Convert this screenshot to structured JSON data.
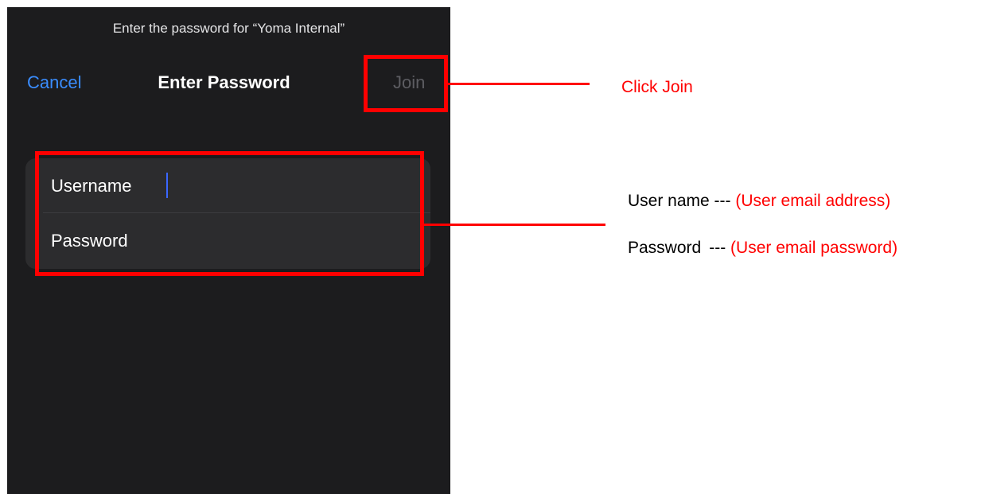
{
  "dialog": {
    "prompt": "Enter the password for “Yoma Internal”",
    "title": "Enter Password",
    "cancel_label": "Cancel",
    "join_label": "Join",
    "fields": [
      {
        "label": "Username",
        "value": ""
      },
      {
        "label": "Password",
        "value": ""
      }
    ]
  },
  "annotations": {
    "join": "Click Join",
    "username_label": "User name ---",
    "username_hint": "(User email address)",
    "password_label": "Password",
    "password_sep": "---",
    "password_hint": "(User email password)"
  },
  "colors": {
    "highlight": "#ff0000",
    "accent": "#3a8dff",
    "background": "#1c1c1e"
  }
}
